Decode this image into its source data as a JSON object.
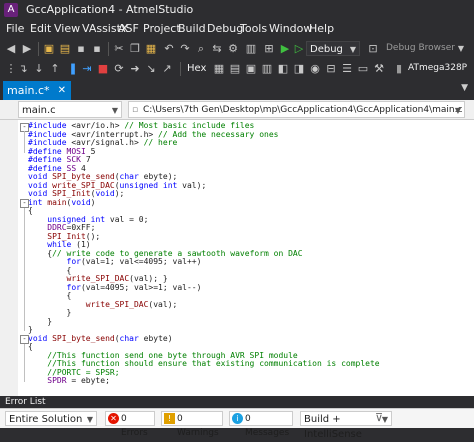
{
  "window": {
    "title": "GccApplication4 - AtmelStudio",
    "icon": "atmel-studio-icon"
  },
  "menu": [
    "File",
    "Edit",
    "View",
    "VAssistX",
    "ASF",
    "Project",
    "Build",
    "Debug",
    "Tools",
    "Window",
    "Help"
  ],
  "toolbar": {
    "config_combo": "Debug",
    "debug_browser": "Debug Browser",
    "hex_label": "Hex",
    "device": "ATmega328P"
  },
  "tab": {
    "label": "main.c*"
  },
  "nav": {
    "file_combo": "main.c",
    "path_combo": "C:\\Users\\7th Gen\\Desktop\\mp\\GccApplication4\\GccApplication4\\main.c"
  },
  "code_lines": [
    "#include <avr/io.h> // Most basic include files",
    "#include <avr/interrupt.h> // Add the necessary ones",
    "#include <avr/signal.h> // here",
    "#define MOSI 5",
    "#define SCK 7",
    "#define SS 4",
    "void SPI_byte_send(char ebyte);",
    "void write_SPI_DAC(unsigned int val);",
    "void SPI_Init(void);",
    "int main(void)",
    "{",
    "    unsigned int val = 0;",
    "    DDRC=0xFF;",
    "    SPI_Init();",
    "    while (1)",
    "    {// write code to generate a sawtooth waveform on DAC",
    "        for(val=1; val<=4095; val++)",
    "        {",
    "        write_SPI_DAC(val); }",
    "        for(val=4095; val>=1; val--)",
    "        {",
    "            write_SPI_DAC(val);",
    "        }",
    "    }",
    "}",
    "void SPI_byte_send(char ebyte)",
    "{",
    "    //This function send one byte through AVR SPI module",
    "    //This function should ensure that existing communication is complete",
    "    //PORTC = SPSR;",
    "    SPDR = ebyte;"
  ],
  "error_list": {
    "title": "Error List",
    "scope": "Entire Solution",
    "errors": "0 Errors",
    "warnings": "0 Warnings",
    "messages": "0 Messages",
    "build_filter": "Build + IntelliSense"
  }
}
